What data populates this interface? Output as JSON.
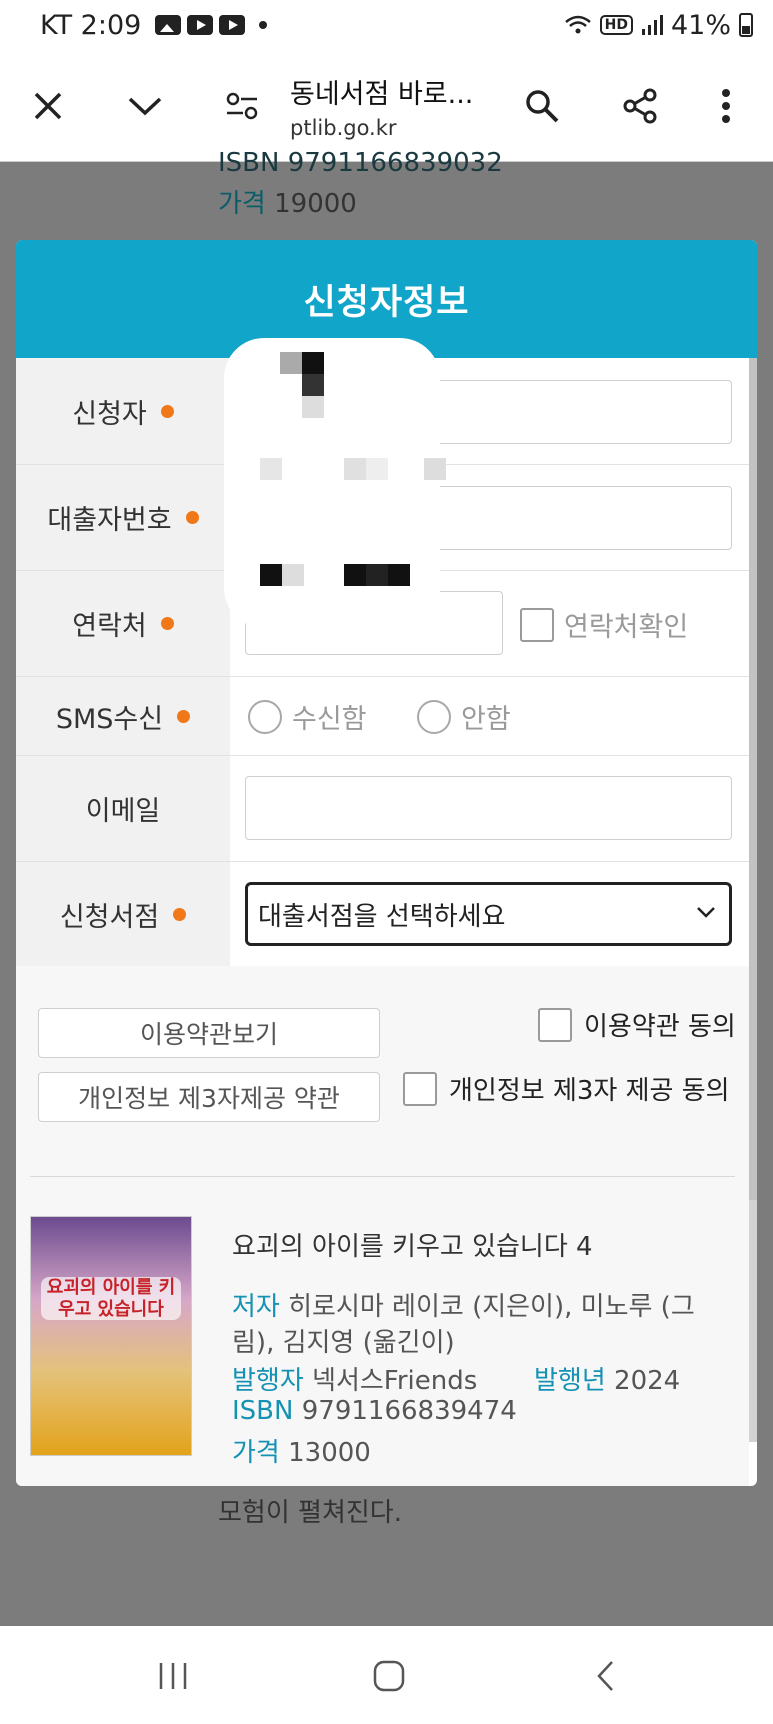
{
  "status_bar": {
    "carrier_time": "KT 2:09",
    "battery": "41%",
    "hd_badge": "HD"
  },
  "browser": {
    "title": "동네서점 바로...",
    "url": "ptlib.go.kr"
  },
  "background_page": {
    "top_isbn": "ISBN 9791166839032",
    "top_price_label": "가격",
    "top_price_value": "19000",
    "bottom_text": "모험이 펼쳐진다."
  },
  "modal": {
    "title": "신청자정보",
    "fields": {
      "applicant_label": "신청자",
      "borrower_label": "대출자번호",
      "contact_label": "연락처",
      "contact_confirm_label": "연락처확인",
      "sms_label": "SMS수신",
      "sms_yes": "수신함",
      "sms_no": "안함",
      "email_label": "이메일",
      "store_label": "신청서점",
      "store_select_value": "대출서점을 선택하세요"
    },
    "terms": {
      "view_terms_button": "이용약관보기",
      "privacy_button": "개인정보 제3자제공 약관",
      "agree_terms": "이용약관 동의",
      "agree_privacy": "개인정보 제3자 제공 동의"
    },
    "book": {
      "cover_text": "요괴의 아이를 키우고 있습니다",
      "title": "요괴의 아이를 키우고 있습니다 4",
      "author_label": "저자",
      "author_value": "히로시마 레이코 (지은이), 미노루 (그",
      "author_value_2": "림), 김지영 (옮긴이)",
      "publisher_label": "발행자",
      "publisher_value": "넥서스Friends",
      "year_label": "발행년",
      "year_value": "2024",
      "isbn_label": "ISBN",
      "isbn_value": "9791166839474",
      "price_label": "가격",
      "price_value": "13000"
    }
  }
}
